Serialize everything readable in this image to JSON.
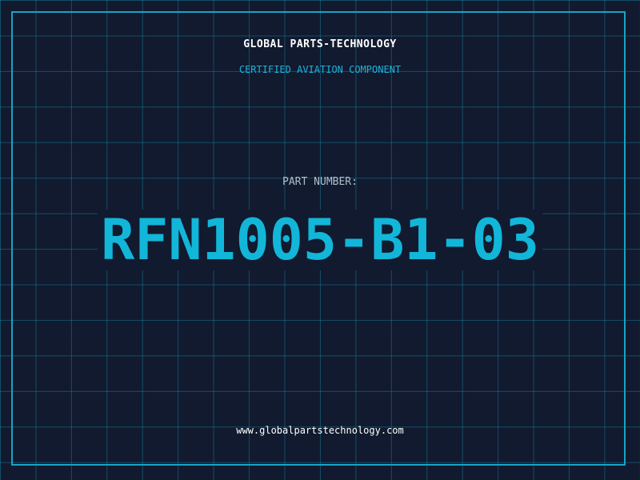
{
  "header": {
    "company": "GLOBAL PARTS-TECHNOLOGY",
    "tagline": "CERTIFIED AVIATION COMPONENT"
  },
  "part": {
    "label": "PART NUMBER:",
    "number": "RFN1005-B1-03"
  },
  "footer": {
    "website": "www.globalpartstechnology.com"
  },
  "colors": {
    "background": "#111a2f",
    "grid": "#16788f",
    "accent": "#1aa3c8",
    "part_number": "#12b6d8"
  }
}
